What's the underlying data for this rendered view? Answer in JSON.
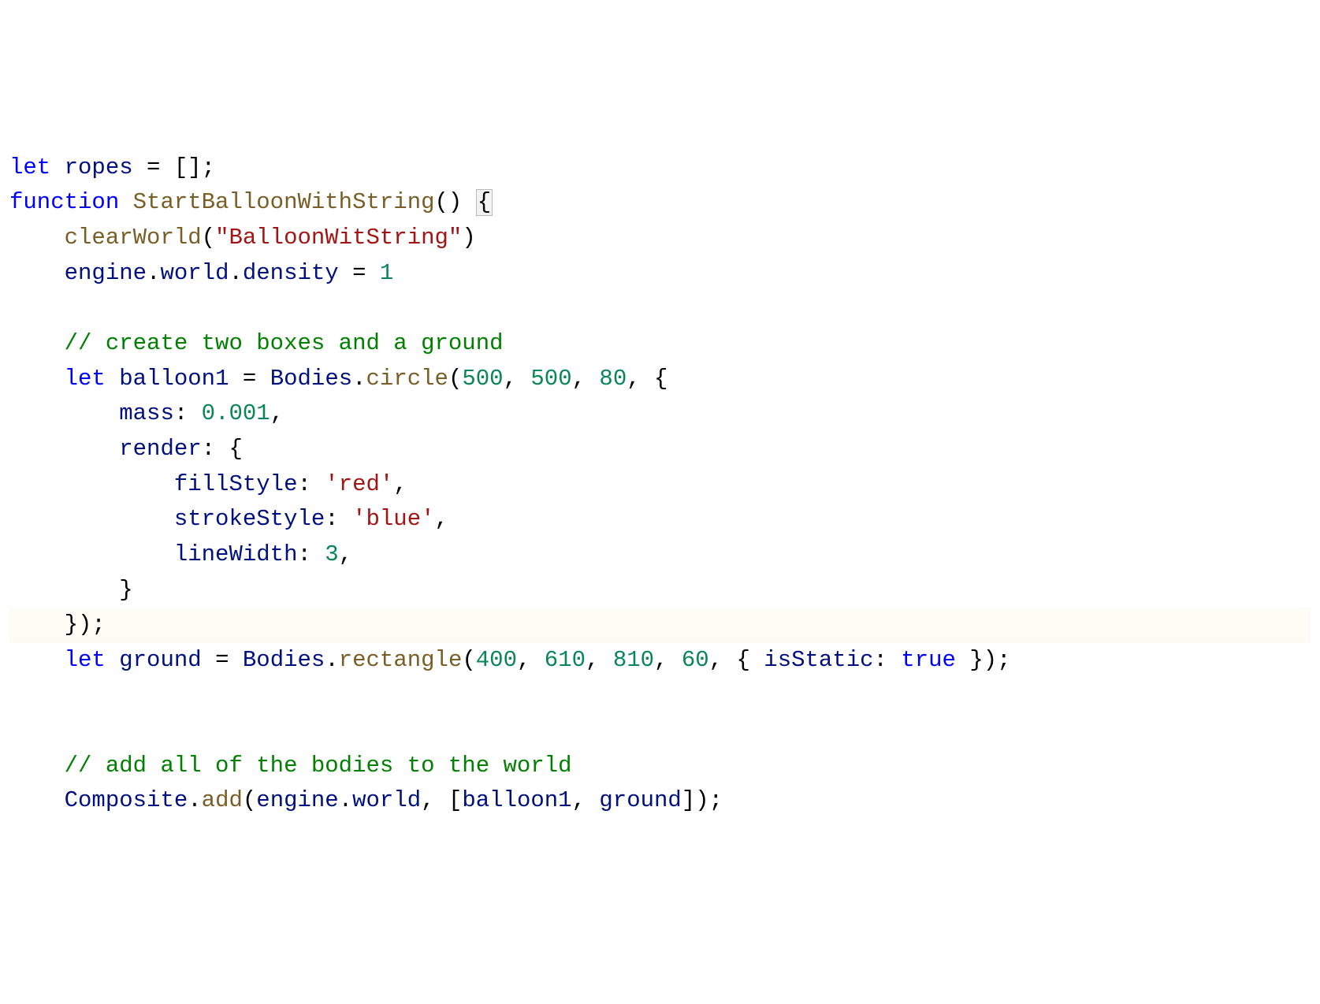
{
  "code": {
    "lines": [
      [
        {
          "t": "let",
          "c": "tok-keyword"
        },
        {
          "t": " ropes ",
          "c": "tok-ident"
        },
        {
          "t": "=",
          "c": "tok-punct"
        },
        {
          "t": " ",
          "c": ""
        },
        {
          "t": "[]",
          "c": "tok-punct"
        },
        {
          "t": ";",
          "c": "tok-punct"
        }
      ],
      [
        {
          "t": "function",
          "c": "tok-keyword"
        },
        {
          "t": " ",
          "c": ""
        },
        {
          "t": "StartBalloonWithString",
          "c": "tok-funcname"
        },
        {
          "t": "()",
          "c": "tok-punct"
        },
        {
          "t": " ",
          "c": ""
        },
        {
          "t": "{",
          "c": "tok-punct match-brace"
        }
      ],
      [
        {
          "t": "    ",
          "c": ""
        },
        {
          "t": "clearWorld",
          "c": "tok-method"
        },
        {
          "t": "(",
          "c": "tok-punct"
        },
        {
          "t": "\"BalloonWitString\"",
          "c": "tok-string"
        },
        {
          "t": ")",
          "c": "tok-punct"
        }
      ],
      [
        {
          "t": "    ",
          "c": ""
        },
        {
          "t": "engine",
          "c": "tok-ident"
        },
        {
          "t": ".",
          "c": "tok-punct"
        },
        {
          "t": "world",
          "c": "tok-ident"
        },
        {
          "t": ".",
          "c": "tok-punct"
        },
        {
          "t": "density",
          "c": "tok-ident"
        },
        {
          "t": " = ",
          "c": "tok-punct"
        },
        {
          "t": "1",
          "c": "tok-number"
        }
      ],
      [
        {
          "t": "",
          "c": ""
        }
      ],
      [
        {
          "t": "    ",
          "c": ""
        },
        {
          "t": "// create two boxes and a ground",
          "c": "tok-comment"
        }
      ],
      [
        {
          "t": "    ",
          "c": ""
        },
        {
          "t": "let",
          "c": "tok-keyword"
        },
        {
          "t": " ",
          "c": ""
        },
        {
          "t": "balloon1",
          "c": "tok-ident"
        },
        {
          "t": " = ",
          "c": "tok-punct"
        },
        {
          "t": "Bodies",
          "c": "tok-ident"
        },
        {
          "t": ".",
          "c": "tok-punct"
        },
        {
          "t": "circle",
          "c": "tok-method"
        },
        {
          "t": "(",
          "c": "tok-punct"
        },
        {
          "t": "500",
          "c": "tok-number"
        },
        {
          "t": ", ",
          "c": "tok-punct"
        },
        {
          "t": "500",
          "c": "tok-number"
        },
        {
          "t": ", ",
          "c": "tok-punct"
        },
        {
          "t": "80",
          "c": "tok-number"
        },
        {
          "t": ", {",
          "c": "tok-punct"
        }
      ],
      [
        {
          "t": "        ",
          "c": ""
        },
        {
          "t": "mass",
          "c": "tok-ident"
        },
        {
          "t": ": ",
          "c": "tok-punct"
        },
        {
          "t": "0.001",
          "c": "tok-number"
        },
        {
          "t": ",",
          "c": "tok-punct"
        }
      ],
      [
        {
          "t": "        ",
          "c": ""
        },
        {
          "t": "render",
          "c": "tok-ident"
        },
        {
          "t": ": {",
          "c": "tok-punct"
        }
      ],
      [
        {
          "t": "            ",
          "c": ""
        },
        {
          "t": "fillStyle",
          "c": "tok-ident"
        },
        {
          "t": ": ",
          "c": "tok-punct"
        },
        {
          "t": "'red'",
          "c": "tok-string"
        },
        {
          "t": ",",
          "c": "tok-punct"
        }
      ],
      [
        {
          "t": "            ",
          "c": ""
        },
        {
          "t": "strokeStyle",
          "c": "tok-ident"
        },
        {
          "t": ": ",
          "c": "tok-punct"
        },
        {
          "t": "'blue'",
          "c": "tok-string"
        },
        {
          "t": ",",
          "c": "tok-punct"
        }
      ],
      [
        {
          "t": "            ",
          "c": ""
        },
        {
          "t": "lineWidth",
          "c": "tok-ident"
        },
        {
          "t": ": ",
          "c": "tok-punct"
        },
        {
          "t": "3",
          "c": "tok-number"
        },
        {
          "t": ",",
          "c": "tok-punct"
        }
      ],
      [
        {
          "t": "        }",
          "c": "tok-punct"
        }
      ],
      [
        {
          "t": "    });",
          "c": "tok-punct"
        }
      ],
      [
        {
          "t": "    ",
          "c": ""
        },
        {
          "t": "let",
          "c": "tok-keyword"
        },
        {
          "t": " ",
          "c": ""
        },
        {
          "t": "ground",
          "c": "tok-ident"
        },
        {
          "t": " = ",
          "c": "tok-punct"
        },
        {
          "t": "Bodies",
          "c": "tok-ident"
        },
        {
          "t": ".",
          "c": "tok-punct"
        },
        {
          "t": "rectangle",
          "c": "tok-method"
        },
        {
          "t": "(",
          "c": "tok-punct"
        },
        {
          "t": "400",
          "c": "tok-number"
        },
        {
          "t": ", ",
          "c": "tok-punct"
        },
        {
          "t": "610",
          "c": "tok-number"
        },
        {
          "t": ", ",
          "c": "tok-punct"
        },
        {
          "t": "810",
          "c": "tok-number"
        },
        {
          "t": ", ",
          "c": "tok-punct"
        },
        {
          "t": "60",
          "c": "tok-number"
        },
        {
          "t": ", { ",
          "c": "tok-punct"
        },
        {
          "t": "isStatic",
          "c": "tok-ident"
        },
        {
          "t": ": ",
          "c": "tok-punct"
        },
        {
          "t": "true",
          "c": "tok-bool"
        },
        {
          "t": " });",
          "c": "tok-punct"
        }
      ],
      [
        {
          "t": "",
          "c": ""
        }
      ],
      [
        {
          "t": "",
          "c": ""
        }
      ],
      [
        {
          "t": "    ",
          "c": ""
        },
        {
          "t": "// add all of the bodies to the world",
          "c": "tok-comment"
        }
      ],
      [
        {
          "t": "    ",
          "c": ""
        },
        {
          "t": "Composite",
          "c": "tok-ident"
        },
        {
          "t": ".",
          "c": "tok-punct"
        },
        {
          "t": "add",
          "c": "tok-method"
        },
        {
          "t": "(",
          "c": "tok-punct"
        },
        {
          "t": "engine",
          "c": "tok-ident"
        },
        {
          "t": ".",
          "c": "tok-punct"
        },
        {
          "t": "world",
          "c": "tok-ident"
        },
        {
          "t": ", [",
          "c": "tok-punct"
        },
        {
          "t": "balloon1",
          "c": "tok-ident"
        },
        {
          "t": ", ",
          "c": "tok-punct"
        },
        {
          "t": "ground",
          "c": "tok-ident"
        },
        {
          "t": "]);",
          "c": "tok-punct"
        }
      ]
    ]
  }
}
